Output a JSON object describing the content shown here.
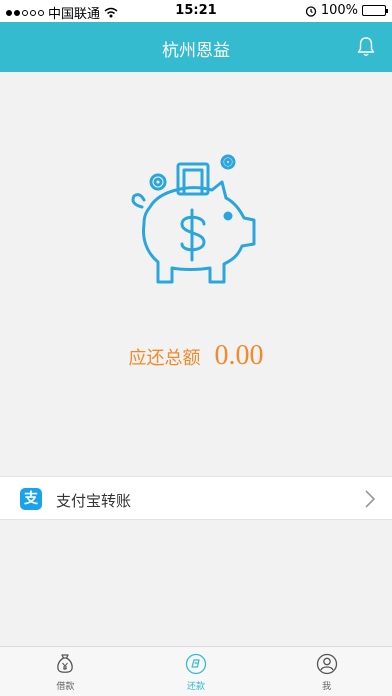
{
  "status_bar": {
    "carrier": "中国联通",
    "time": "15:21",
    "battery": "100%"
  },
  "nav": {
    "title": "杭州恩益"
  },
  "repayment": {
    "label": "应还总额",
    "amount": "0.00"
  },
  "alipay": {
    "icon_glyph": "支",
    "label": "支付宝转账"
  },
  "tabs": [
    {
      "label": "借款",
      "icon": "money-bag-icon",
      "active": false
    },
    {
      "label": "还款",
      "icon": "repay-icon",
      "active": true
    },
    {
      "label": "我",
      "icon": "user-icon",
      "active": false
    }
  ],
  "colors": {
    "brand": "#35bbd0",
    "amount": "#f08a2c",
    "alipay": "#1aa3e8",
    "icon_stroke": "#2aa6dd"
  }
}
